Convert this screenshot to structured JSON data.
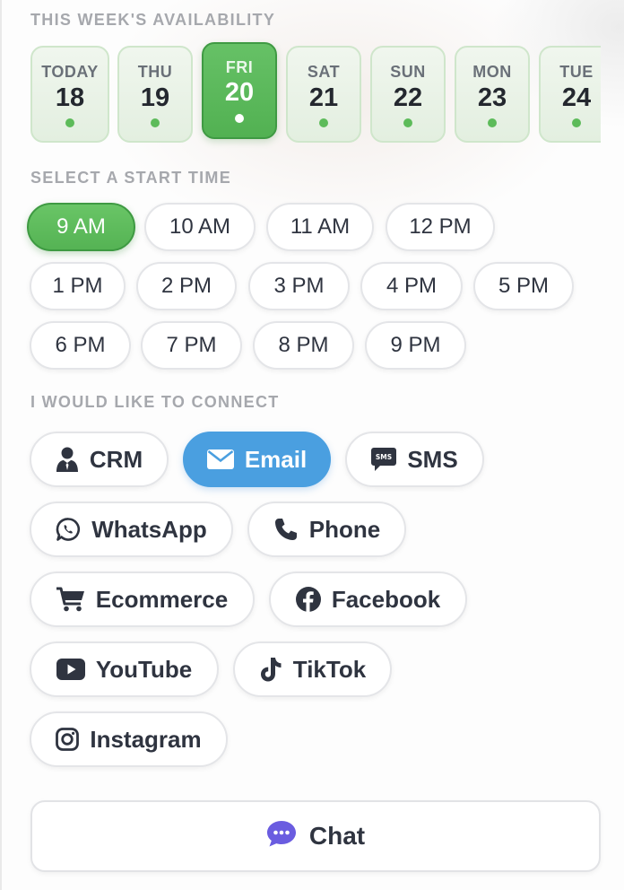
{
  "availability": {
    "label": "THIS WEEK'S AVAILABILITY",
    "days": [
      {
        "name": "TODAY",
        "num": "18",
        "selected": false
      },
      {
        "name": "THU",
        "num": "19",
        "selected": false
      },
      {
        "name": "FRI",
        "num": "20",
        "selected": true
      },
      {
        "name": "SAT",
        "num": "21",
        "selected": false
      },
      {
        "name": "SUN",
        "num": "22",
        "selected": false
      },
      {
        "name": "MON",
        "num": "23",
        "selected": false
      },
      {
        "name": "TUE",
        "num": "24",
        "selected": false
      }
    ]
  },
  "start_time": {
    "label": "SELECT A START TIME",
    "times": [
      "9 AM",
      "10 AM",
      "11 AM",
      "12 PM",
      "1 PM",
      "2 PM",
      "3 PM",
      "4 PM",
      "5 PM",
      "6 PM",
      "7 PM",
      "8 PM",
      "9 PM"
    ],
    "selected": "9 AM"
  },
  "connect": {
    "label": "I WOULD LIKE TO CONNECT",
    "options": [
      {
        "label": "CRM",
        "icon": "person-tie-icon"
      },
      {
        "label": "Email",
        "icon": "envelope-icon"
      },
      {
        "label": "SMS",
        "icon": "sms-bubble-icon"
      },
      {
        "label": "WhatsApp",
        "icon": "whatsapp-icon"
      },
      {
        "label": "Phone",
        "icon": "phone-icon"
      },
      {
        "label": "Ecommerce",
        "icon": "cart-icon"
      },
      {
        "label": "Facebook",
        "icon": "facebook-icon"
      },
      {
        "label": "YouTube",
        "icon": "youtube-icon"
      },
      {
        "label": "TikTok",
        "icon": "tiktok-icon"
      },
      {
        "label": "Instagram",
        "icon": "instagram-icon"
      }
    ],
    "selected": "Email"
  },
  "chat": {
    "label": "Chat",
    "icon": "chat-bubble-icon"
  },
  "colors": {
    "green_accent": "#55b354",
    "blue_accent": "#4a9fe0",
    "chat_icon": "#6a5ce0",
    "muted_label": "#a6a8ad"
  }
}
